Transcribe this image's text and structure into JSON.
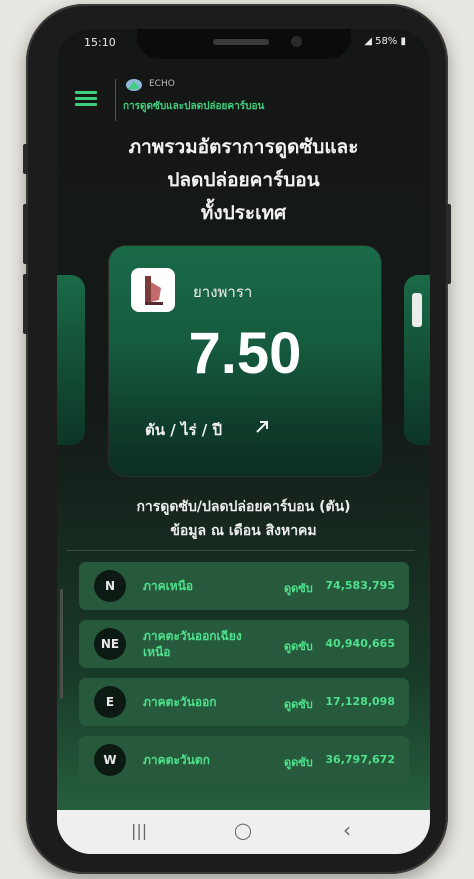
{
  "status": {
    "time": "15:10",
    "battery": "58%"
  },
  "header": {
    "menu_icon": "hamburger-menu-icon",
    "brand": "ECHO",
    "subtitle": "การดูดซับและปลดปล่อยคาร์บอน"
  },
  "page": {
    "title_line1": "ภาพรวมอัตราการดูดซับและ",
    "title_line2": "ปลดปล่อยคาร์บอน",
    "title_line3": "ทั้งประเทศ"
  },
  "card": {
    "icon": "rubber-tree-icon",
    "crop_name": "ยางพารา",
    "value": "7.50",
    "unit": "ตัน / ไร่ / ปี",
    "link_icon": "arrow-up-right-icon"
  },
  "section": {
    "title_line1": "การดูดซับ/ปลดปล่อยคาร์บอน (ตัน)",
    "title_line2": "ข้อมูล ณ เดือน สิงหาคม"
  },
  "regions": [
    {
      "code": "N",
      "name": "ภาคเหนือ",
      "label": "ดูดซับ",
      "value": "74,583,795"
    },
    {
      "code": "NE",
      "name": "ภาคตะวันออกเฉียงเหนือ",
      "label": "ดูดซับ",
      "value": "40,940,665"
    },
    {
      "code": "E",
      "name": "ภาคตะวันออก",
      "label": "ดูดซับ",
      "value": "17,128,098"
    },
    {
      "code": "W",
      "name": "ภาคตะวันตก",
      "label": "ดูดซับ",
      "value": "36,797,672"
    }
  ],
  "navbar": {
    "recent": "|||",
    "home": "◯",
    "back": "‹"
  },
  "colors": {
    "accent": "#3fcf7f",
    "card": "#155a3e"
  }
}
